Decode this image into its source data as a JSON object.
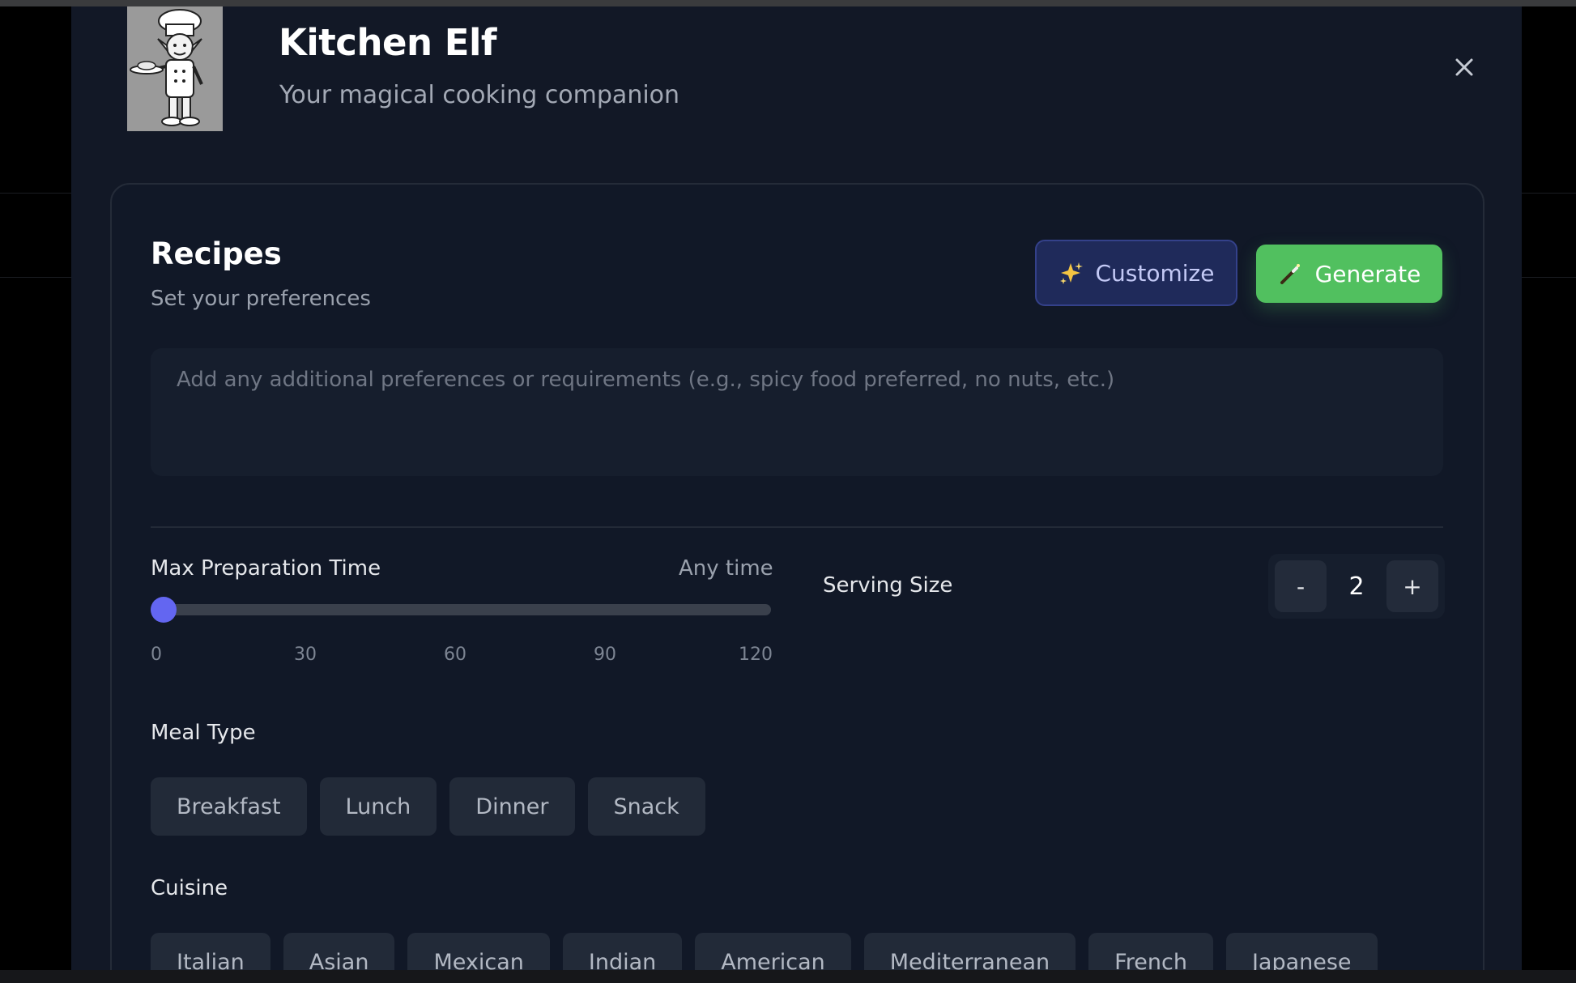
{
  "header": {
    "title": "Kitchen Elf",
    "subtitle": "Your magical cooking companion",
    "logo_icon": "chef-elf-logo",
    "close_icon": "close-icon"
  },
  "card": {
    "title": "Recipes",
    "subtitle": "Set your preferences",
    "customize_label": "Customize",
    "customize_icon": "sparkles-icon",
    "generate_label": "Generate",
    "generate_icon": "magic-wand-icon",
    "preferences_placeholder": "Add any additional preferences or requirements (e.g., spicy food preferred, no nuts, etc.)",
    "preferences_value": ""
  },
  "prep_time": {
    "label": "Max Preparation Time",
    "value_text": "Any time",
    "value": 0,
    "min": 0,
    "max": 120,
    "ticks": [
      "0",
      "30",
      "60",
      "90",
      "120"
    ]
  },
  "serving": {
    "label": "Serving Size",
    "decrement": "-",
    "value": "2",
    "increment": "+"
  },
  "meal_type": {
    "label": "Meal Type",
    "options": [
      "Breakfast",
      "Lunch",
      "Dinner",
      "Snack"
    ]
  },
  "cuisine": {
    "label": "Cuisine",
    "options": [
      "Italian",
      "Asian",
      "Mexican",
      "Indian",
      "American",
      "Mediterranean",
      "French",
      "Japanese"
    ]
  },
  "colors": {
    "accent": "#6366f1",
    "generate": "#51c05f",
    "customize_bg": "#1f2a5a",
    "modal_bg": "#121826"
  }
}
